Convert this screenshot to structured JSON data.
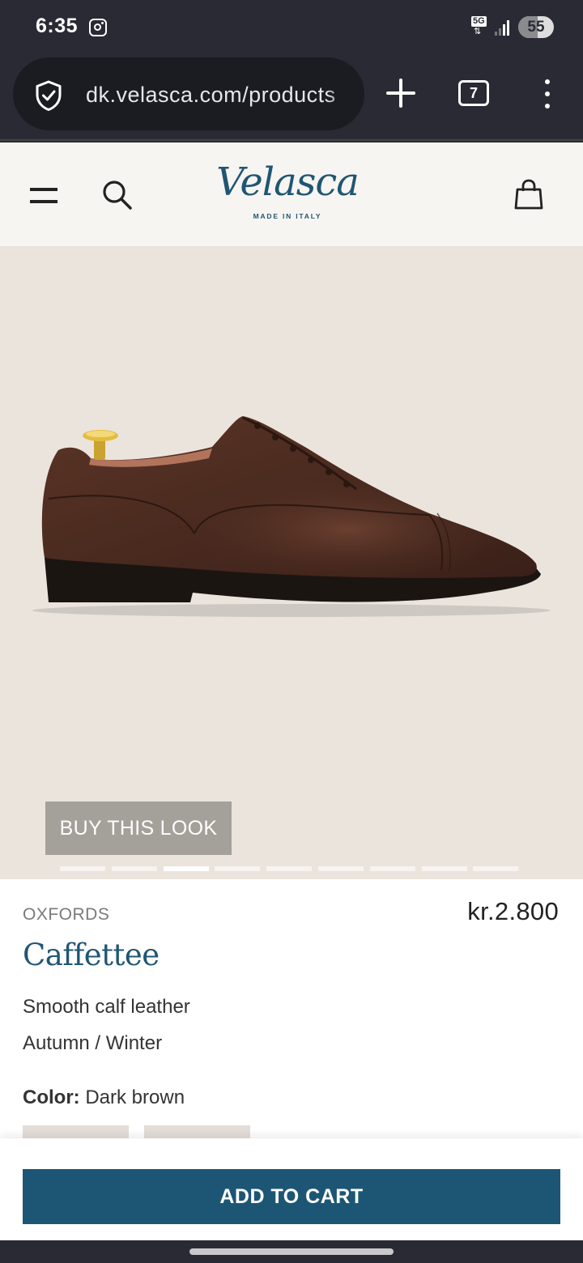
{
  "status_bar": {
    "time": "6:35",
    "network": "5G",
    "battery": "55",
    "battery_level": 0.55
  },
  "browser": {
    "url": "dk.velasca.com/products",
    "tab_count": "7"
  },
  "header": {
    "logo": "Velasca",
    "logo_tagline": "MADE IN ITALY",
    "brand_color": "#1f5673"
  },
  "gallery": {
    "buy_look_label": "BUY THIS LOOK",
    "image_count": 9,
    "active_index": 2
  },
  "product": {
    "category": "OXFORDS",
    "price": "kr.2.800",
    "name": "Caffettee",
    "material": "Smooth calf leather",
    "season": "Autumn / Winter",
    "color_label": "Color:",
    "color_value": "Dark brown"
  },
  "cta": {
    "add_to_cart": "ADD TO CART",
    "color": "#1d5674"
  }
}
